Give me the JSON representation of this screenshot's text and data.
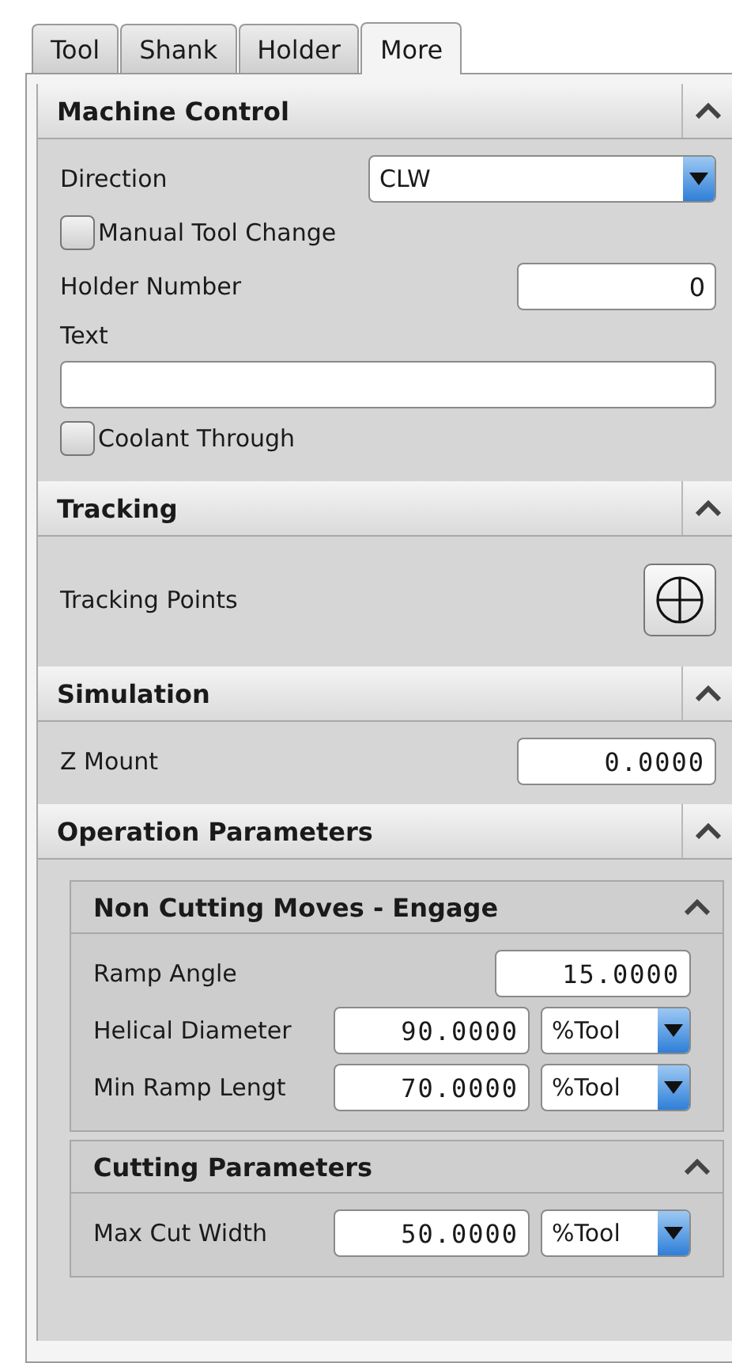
{
  "tabs": [
    {
      "label": "Tool",
      "selected": false
    },
    {
      "label": "Shank",
      "selected": false
    },
    {
      "label": "Holder",
      "selected": false
    },
    {
      "label": "More",
      "selected": true
    }
  ],
  "sections": [
    {
      "title": "Machine Control",
      "expanded": true,
      "rows": [
        {
          "kind": "select",
          "label": "Direction",
          "value": "CLW"
        },
        {
          "kind": "checkbox",
          "label": "Manual Tool Change",
          "checked": false
        },
        {
          "kind": "number",
          "label": "Holder Number",
          "value": "0"
        },
        {
          "kind": "label",
          "label": "Text"
        },
        {
          "kind": "textfield"
        },
        {
          "kind": "checkbox",
          "label": "Coolant Through",
          "checked": false
        }
      ]
    },
    {
      "title": "Tracking",
      "expanded": true,
      "rows": [
        {
          "kind": "button",
          "label": "Tracking Points"
        }
      ]
    },
    {
      "title": "Simulation",
      "expanded": true,
      "rows": [
        {
          "kind": "number",
          "label": "Z Mount",
          "value": "0.0000"
        }
      ]
    },
    {
      "title": "Operation Parameters",
      "expanded": true,
      "subsections": [
        {
          "title": "Non Cutting Moves - Engage",
          "expanded": true,
          "rows": [
            {
              "kind": "number",
              "label": "Ramp Angle",
              "value": "15.0000"
            },
            {
              "kind": "unit",
              "label": "Helical Diameter",
              "value": "90.0000",
              "unit": "%Tool"
            },
            {
              "kind": "unit",
              "label": "Min Ramp Lengt",
              "value": "70.0000",
              "unit": "%Tool"
            }
          ]
        },
        {
          "title": "Cutting Parameters",
          "expanded": true,
          "rows": [
            {
              "kind": "unit",
              "label": "Max Cut Width",
              "value": "50.0000",
              "unit": "%Tool"
            }
          ]
        }
      ]
    }
  ]
}
